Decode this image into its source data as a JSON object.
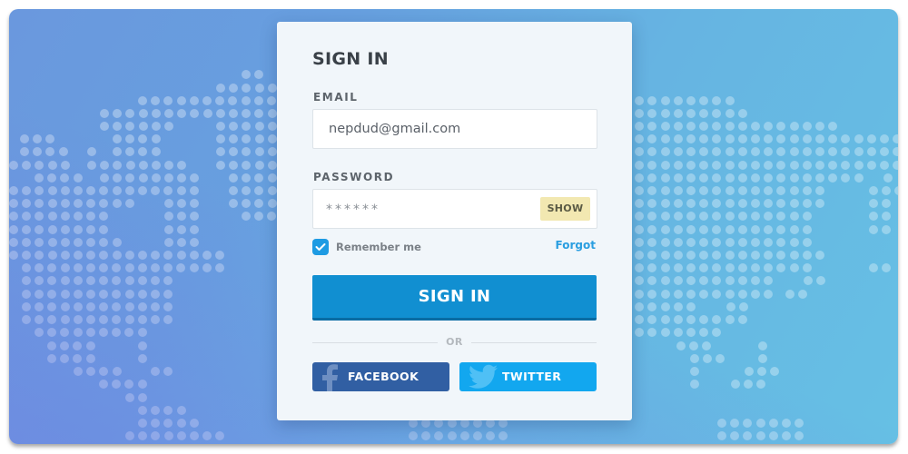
{
  "form": {
    "title": "SIGN IN",
    "email": {
      "label": "EMAIL",
      "value": "nepdud@gmail.com"
    },
    "password": {
      "label": "PASSWORD",
      "masked_value": "******",
      "show_label": "SHOW"
    },
    "remember_me": {
      "label": "Remember me",
      "checked": true
    },
    "forgot_label": "Forgot",
    "submit_label": "SIGN IN",
    "divider_label": "OR",
    "social": {
      "facebook_label": "FACEBOOK",
      "twitter_label": "TWITTER"
    }
  },
  "colors": {
    "primary": "#118fd1",
    "facebook": "#315fa3",
    "twitter": "#12a7ef",
    "show_button": "#f2e8b1",
    "link": "#2a9ee0"
  },
  "background": {
    "icon": "world-map-dots"
  }
}
